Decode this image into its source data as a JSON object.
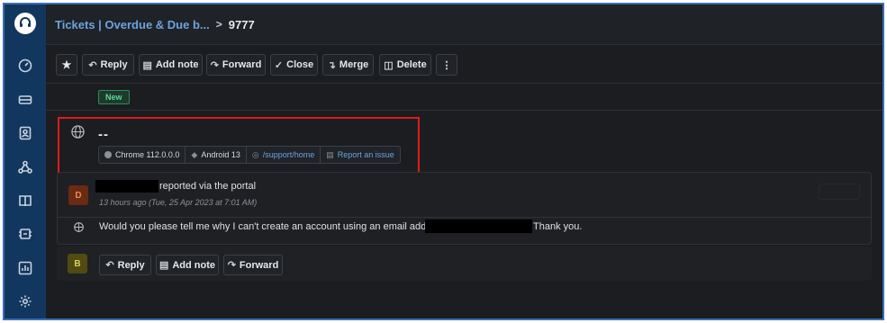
{
  "breadcrumb": {
    "parent": "Tickets | Overdue & Due b...",
    "separator": ">",
    "current": "9777"
  },
  "sidebar": {
    "items": [
      "dashboard-icon",
      "tickets-icon",
      "contacts-icon",
      "groups-icon",
      "knowledge-base-icon",
      "automation-icon",
      "reports-icon",
      "settings-icon"
    ]
  },
  "toolbar": {
    "star_label": "★",
    "reply_label": "Reply",
    "add_note_label": "Add note",
    "forward_label": "Forward",
    "close_label": "Close",
    "merge_label": "Merge",
    "delete_label": "Delete",
    "more_label": "⋮"
  },
  "ticket": {
    "status": "New",
    "subject": "--",
    "browser": "Chrome 112.0.0.0",
    "os": "Android 13",
    "page": "/support/home",
    "report_link": "Report an issue"
  },
  "thread": {
    "avatar_initial": "D",
    "reported_text": "reported via the portal",
    "timestamp": "13 hours ago (Tue, 25 Apr 2023 at 7:01 AM)",
    "message_before": "Would you please tell me why I can't create an account using an email address of",
    "message_after": "Thank you."
  },
  "reply_bar": {
    "avatar_initial": "B",
    "reply_label": "Reply",
    "add_note_label": "Add note",
    "forward_label": "Forward"
  },
  "colors": {
    "accent_link": "#6ba3e0",
    "sidebar": "#12375e",
    "status_new": "#5fd69a",
    "highlight_border": "#e01b1b"
  }
}
